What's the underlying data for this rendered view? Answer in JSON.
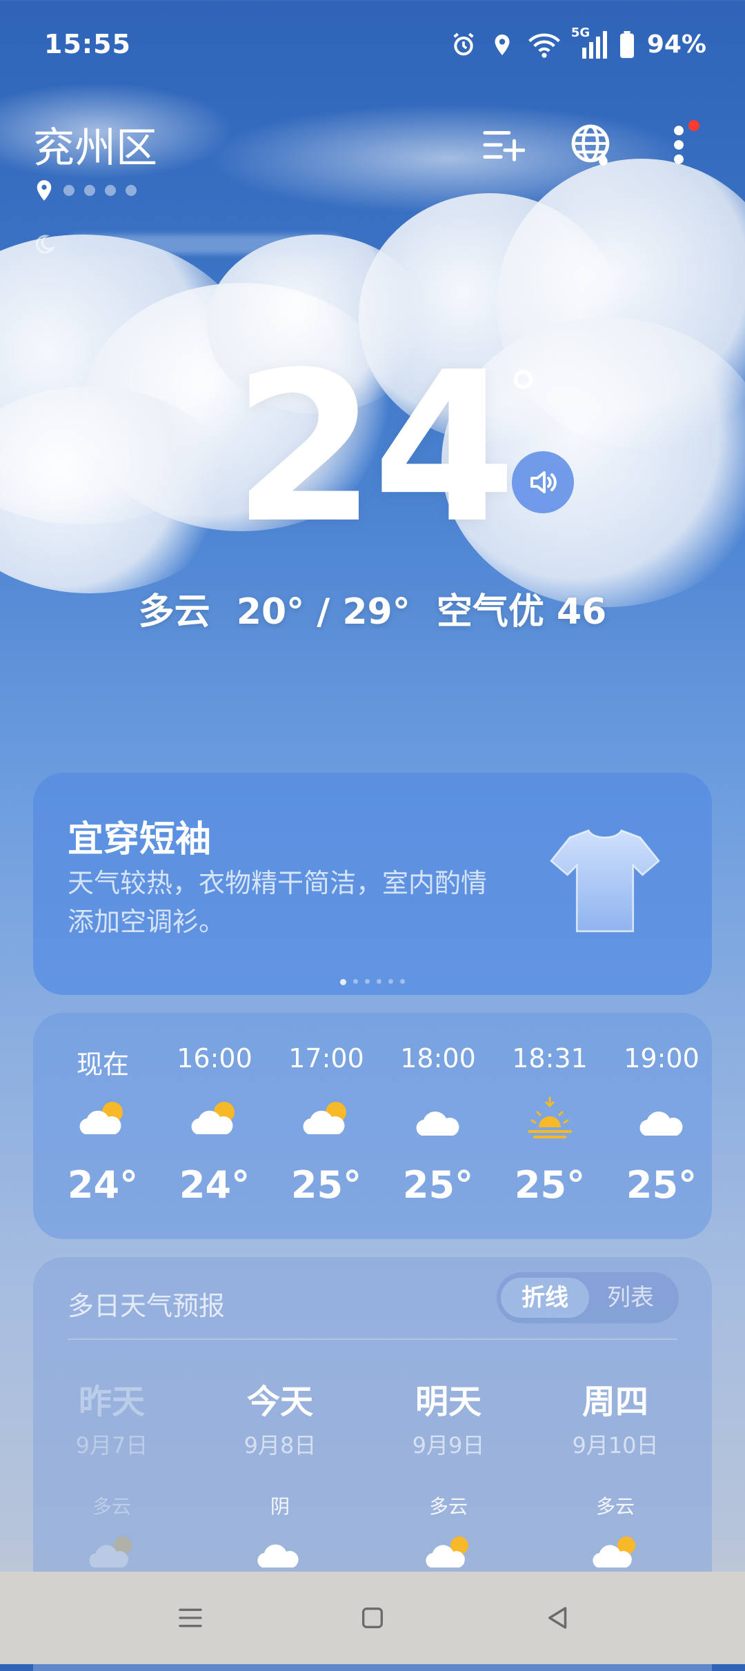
{
  "status_bar": {
    "time": "15:55",
    "network": "5G",
    "battery": "94%",
    "icons": [
      "alarm-icon",
      "location-icon",
      "wifi-icon",
      "signal-5g-icon",
      "battery-icon"
    ]
  },
  "header": {
    "city": "兖州区",
    "page_count": 5,
    "actions": [
      "add-city-icon",
      "globe-icon",
      "more-vert-icon"
    ],
    "has_notification": true,
    "notification_color": "#ff3b30"
  },
  "current": {
    "temperature": "24",
    "degree_symbol": "°",
    "condition": "多云",
    "range": "20° / 29°",
    "air_quality": "空气优 46"
  },
  "dress_card": {
    "title": "宜穿短袖",
    "description": "天气较热，衣物精干简洁，室内酌情添加空调衫。",
    "icon": "tshirt-icon",
    "carousel_pages": 6,
    "active_page": 1
  },
  "hourly": [
    {
      "time": "现在",
      "icon": "partly-cloudy-icon",
      "temp": "24°"
    },
    {
      "time": "16:00",
      "icon": "partly-cloudy-icon",
      "temp": "24°"
    },
    {
      "time": "17:00",
      "icon": "partly-cloudy-icon",
      "temp": "25°"
    },
    {
      "time": "18:00",
      "icon": "cloudy-icon",
      "temp": "25°"
    },
    {
      "time": "18:31",
      "icon": "sunset-icon",
      "temp": "25°"
    },
    {
      "time": "19:00",
      "icon": "cloudy-icon",
      "temp": "25°"
    }
  ],
  "forecast": {
    "title": "多日天气预报",
    "toggle": {
      "active": "折线",
      "inactive": "列表"
    },
    "days": [
      {
        "name": "昨天",
        "date": "9月7日",
        "condition": "多云",
        "icon": "partly-cloudy-icon",
        "past": true
      },
      {
        "name": "今天",
        "date": "9月8日",
        "condition": "阴",
        "icon": "cloudy-icon",
        "past": false
      },
      {
        "name": "明天",
        "date": "9月9日",
        "condition": "多云",
        "icon": "partly-cloudy-icon",
        "past": false
      },
      {
        "name": "周四",
        "date": "9月10日",
        "condition": "多云",
        "icon": "partly-cloudy-icon",
        "past": false
      }
    ]
  },
  "nav": [
    "menu-icon",
    "home-icon",
    "back-icon"
  ],
  "colors": {
    "sun": "#f7b928",
    "card_blue": "#568ce2"
  }
}
